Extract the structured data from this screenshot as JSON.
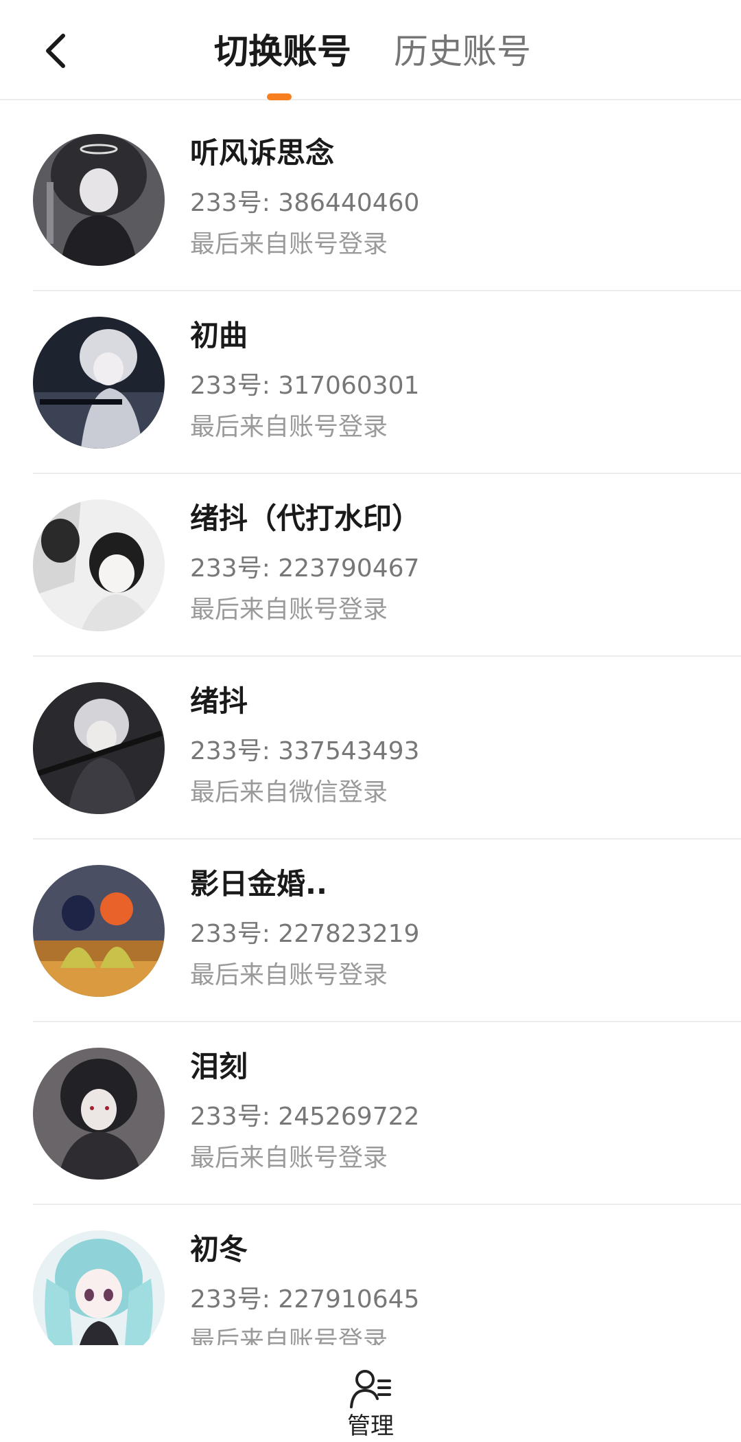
{
  "header": {
    "tabs": [
      {
        "label": "切换账号",
        "active": true
      },
      {
        "label": "历史账号",
        "active": false
      }
    ],
    "accent_color": "#f77f1f"
  },
  "accounts": [
    {
      "name": "听风诉思念",
      "uid": "233号: 386440460",
      "source": "最后来自账号登录",
      "avatar_icon": "anime-avatar-icon"
    },
    {
      "name": "初曲",
      "uid": "233号: 317060301",
      "source": "最后来自账号登录",
      "avatar_icon": "anime-avatar-icon"
    },
    {
      "name": "绪抖（代打水印）",
      "uid": "233号: 223790467",
      "source": "最后来自账号登录",
      "avatar_icon": "anime-avatar-icon"
    },
    {
      "name": "绪抖",
      "uid": "233号: 337543493",
      "source": "最后来自微信登录",
      "avatar_icon": "anime-avatar-icon"
    },
    {
      "name": "影日金婚..",
      "uid": "233号: 227823219",
      "source": "最后来自账号登录",
      "avatar_icon": "anime-avatar-icon"
    },
    {
      "name": "泪刻",
      "uid": "233号: 245269722",
      "source": "最后来自账号登录",
      "avatar_icon": "anime-avatar-icon"
    },
    {
      "name": "初冬",
      "uid": "233号: 227910645",
      "source": "最后来自账号登录",
      "avatar_icon": "anime-avatar-icon"
    }
  ],
  "bottom": {
    "manage_label": "管理",
    "manage_icon": "user-manage-icon"
  }
}
